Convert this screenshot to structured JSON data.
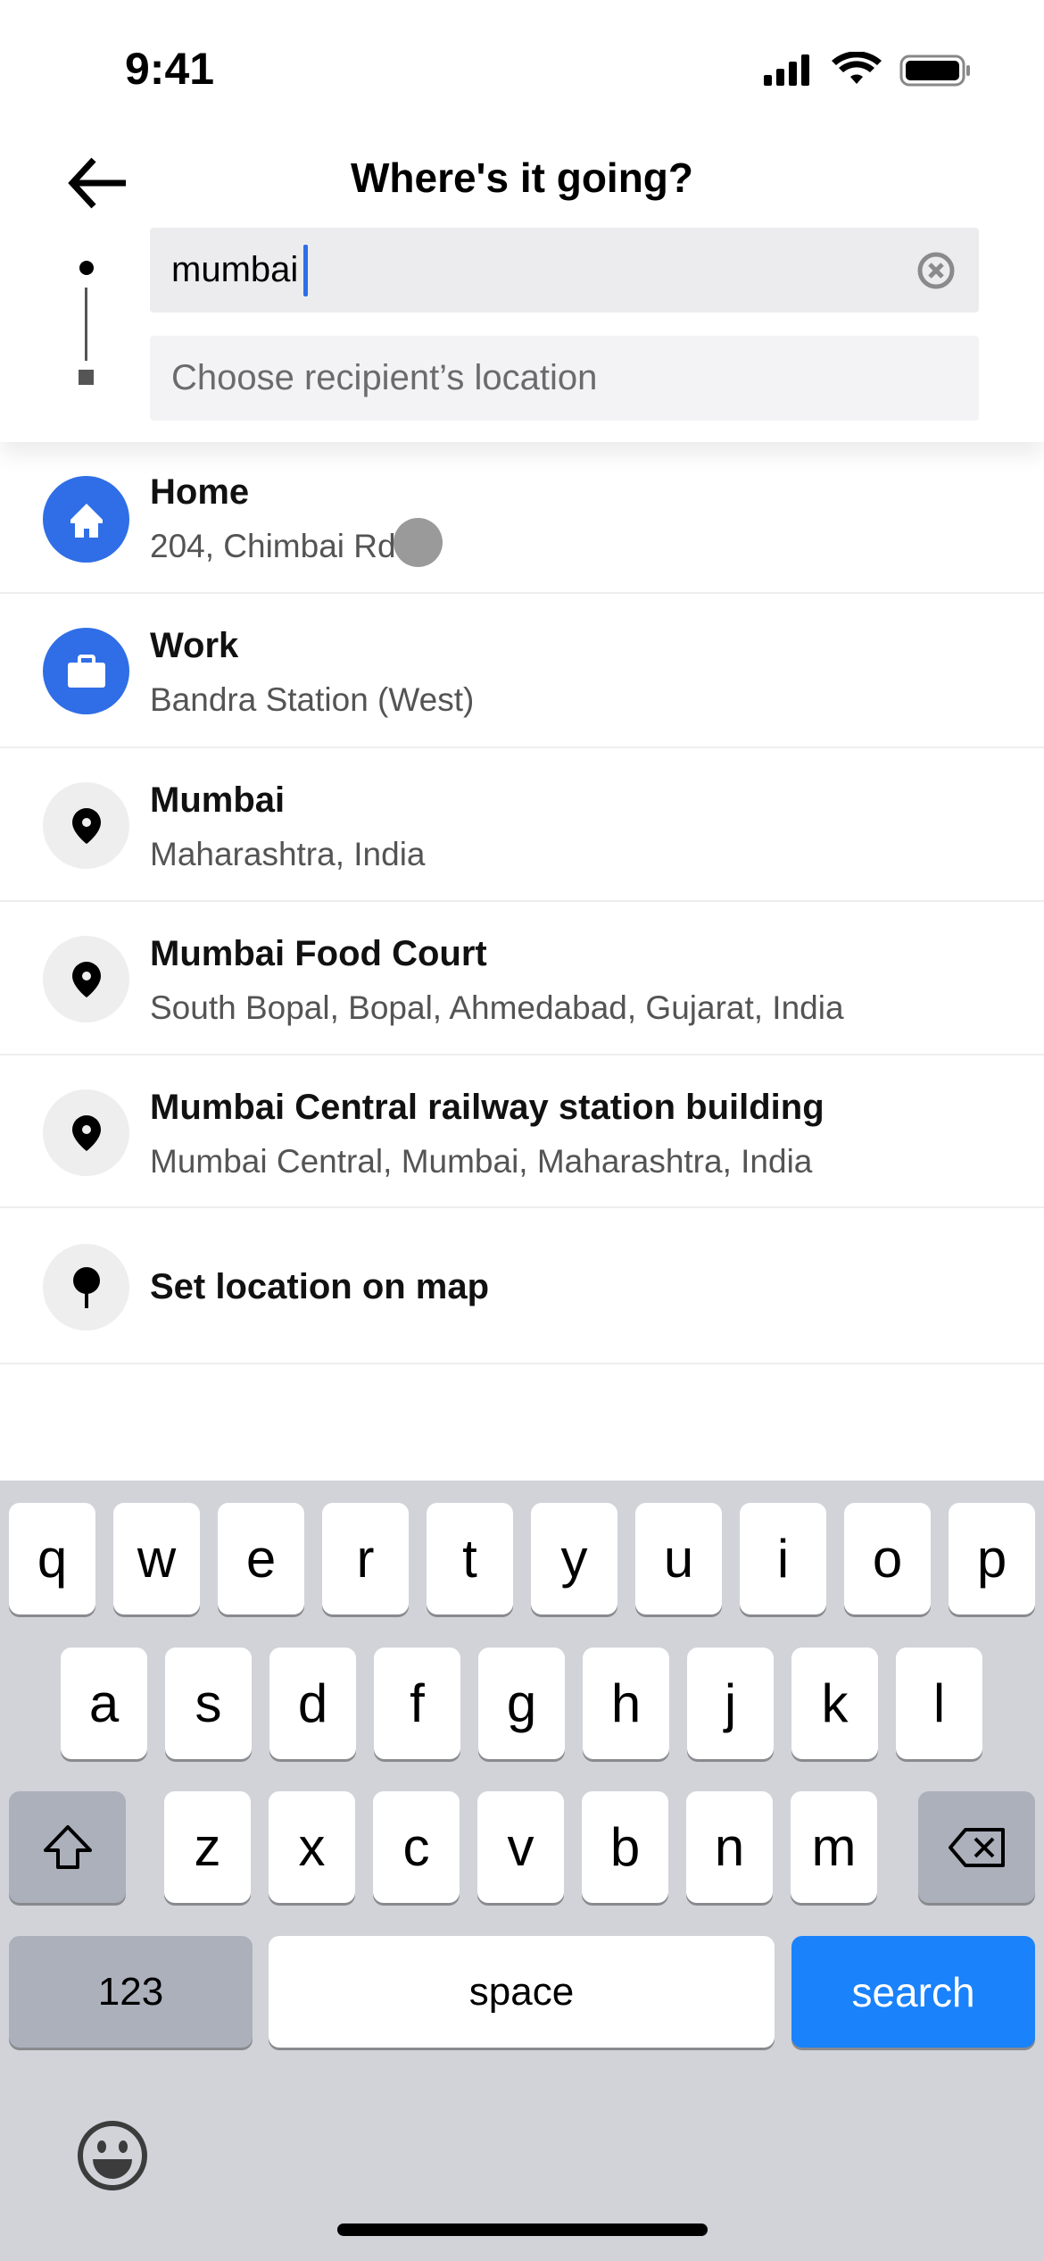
{
  "status": {
    "time": "9:41"
  },
  "header": {
    "title": "Where's it going?",
    "pickup_value": "mumbai",
    "destination_placeholder": "Choose recipient’s location"
  },
  "results": [
    {
      "title": "Home",
      "subtitle": "204, Chimbai Rd",
      "icon": "home-icon"
    },
    {
      "title": "Work",
      "subtitle": "Bandra Station (West)",
      "icon": "briefcase-icon"
    },
    {
      "title": "Mumbai",
      "subtitle": "Maharashtra, India",
      "icon": "pin-icon"
    },
    {
      "title": "Mumbai Food Court",
      "subtitle": "South Bopal, Bopal, Ahmedabad, Gujarat, India",
      "icon": "pin-icon"
    },
    {
      "title": "Mumbai Central railway station building",
      "subtitle": "Mumbai Central, Mumbai, Maharashtra, India",
      "icon": "pin-icon"
    }
  ],
  "set_on_map": "Set location on map",
  "keyboard": {
    "row1": [
      "q",
      "w",
      "e",
      "r",
      "t",
      "y",
      "u",
      "i",
      "o",
      "p"
    ],
    "row2": [
      "a",
      "s",
      "d",
      "f",
      "g",
      "h",
      "j",
      "k",
      "l"
    ],
    "row3": [
      "z",
      "x",
      "c",
      "v",
      "b",
      "n",
      "m"
    ],
    "numbers": "123",
    "space": "space",
    "search": "search"
  },
  "colors": {
    "accent": "#2f6ee6",
    "search_key": "#1a82fb"
  }
}
